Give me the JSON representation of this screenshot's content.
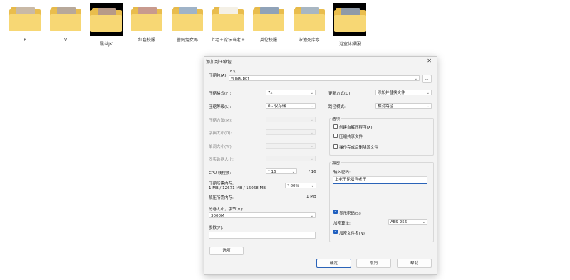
{
  "folders": [
    {
      "name": "P",
      "thumb_color": "#c9b9a6",
      "selected": false
    },
    {
      "name": "V",
      "thumb_color": "#b7a89a",
      "selected": false
    },
    {
      "name": "黑丝JK",
      "thumb_color": "#b79a88",
      "selected": true
    },
    {
      "name": "红色校服",
      "thumb_color": "#c89a8e",
      "selected": false
    },
    {
      "name": "蕾姆兔女郎",
      "thumb_color": "#9fb3c8",
      "selected": false
    },
    {
      "name": "上老王论坛当老王",
      "thumb_color": "#f4f0e6",
      "selected": false
    },
    {
      "name": "英伦校服",
      "thumb_color": "#8fa2b8",
      "selected": false
    },
    {
      "name": "泳池死库水",
      "thumb_color": "#a8b6c2",
      "selected": false
    },
    {
      "name": "浴室体操服",
      "thumb_color": "#8f9aa8",
      "selected": true
    }
  ],
  "dialog": {
    "title": "添加到压缩包",
    "close_glyph": "✕",
    "archive_label": "压缩包(A):",
    "archive_dir": "E:\\",
    "archive_name": "WINK.pdf",
    "browse_label": "...",
    "format_label": "压缩格式(F):",
    "format_value": "7z",
    "level_label": "压缩等级(L):",
    "level_value": "0 - 仅存储",
    "method_label": "压缩方法(M):",
    "dict_label": "字典大小(D):",
    "word_label": "单词大小(W):",
    "solid_label": "固实数据大小:",
    "cpu_label": "CPU 线程数:",
    "cpu_value": "* 16",
    "cpu_total": "/ 16",
    "mem_label": "压缩所需内存:",
    "mem_detail": "1 MB / 12671 MB / 16068 MB",
    "mem_value": "* 80%",
    "decomp_label": "解压所需内存:",
    "decomp_value": "1 MB",
    "split_label": "分卷大小，字节(V):",
    "split_value": "3000M",
    "params_label": "参数(P):",
    "options_button": "选项",
    "update_label": "更新方式(U):",
    "update_value": "添加并替换文件",
    "path_label": "路径模式:",
    "path_value": "相对路径",
    "options_group_title": "选项",
    "opt_sfx": "创建自解压程序(X)",
    "opt_shared": "压缩共享文件",
    "opt_delete": "操作完成后删除源文件",
    "encrypt_group_title": "加密",
    "password_label": "输入密码:",
    "password_value": "上老王论坛当老王",
    "show_password": "显示密码(S)",
    "enc_method_label": "加密算法:",
    "enc_method_value": "AES-256",
    "encrypt_names": "加密文件名(N)",
    "ok_button": "确定",
    "cancel_button": "取消",
    "help_button": "帮助",
    "checkmark": "✓",
    "caret": "⌄"
  }
}
